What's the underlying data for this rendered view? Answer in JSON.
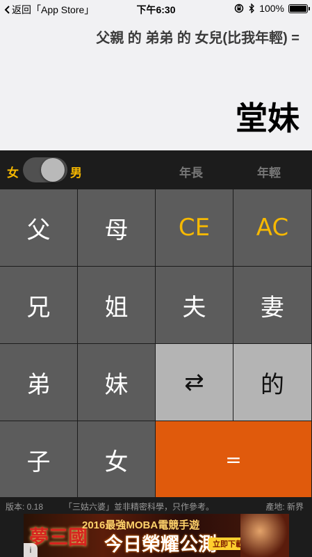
{
  "status_bar": {
    "back_label": "返回「App Store」",
    "time": "下午6:30",
    "battery": "100%"
  },
  "display": {
    "expression": "父親 的 弟弟 的 女兒(比我年輕) =",
    "result": "堂妹"
  },
  "controls": {
    "female_label": "女",
    "male_label": "男",
    "gender_selected": "male",
    "older_label": "年長",
    "younger_label": "年輕"
  },
  "keys": {
    "father": "父",
    "mother": "母",
    "clear_entry": "CE",
    "all_clear": "AC",
    "older_brother": "兄",
    "older_sister": "姐",
    "husband": "夫",
    "wife": "妻",
    "younger_brother": "弟",
    "younger_sister": "妹",
    "swap": "⇄",
    "of": "的",
    "son": "子",
    "daughter": "女",
    "equals": "="
  },
  "footer": {
    "version": "版本: 0.18",
    "disclaimer": "「三姑六婆」並非精密科學，只作參考。",
    "origin": "產地: 新界"
  },
  "ad": {
    "game_logo": "夢三國",
    "headline": "2016最強MOBA電競手遊",
    "main_text": "今日榮耀公測",
    "cta": "立即下載",
    "info_icon": "i"
  },
  "colors": {
    "accent": "#f6b800",
    "key_dark": "#5c5c5c",
    "key_light": "#b4b4b4",
    "equals": "#e05a0c"
  }
}
